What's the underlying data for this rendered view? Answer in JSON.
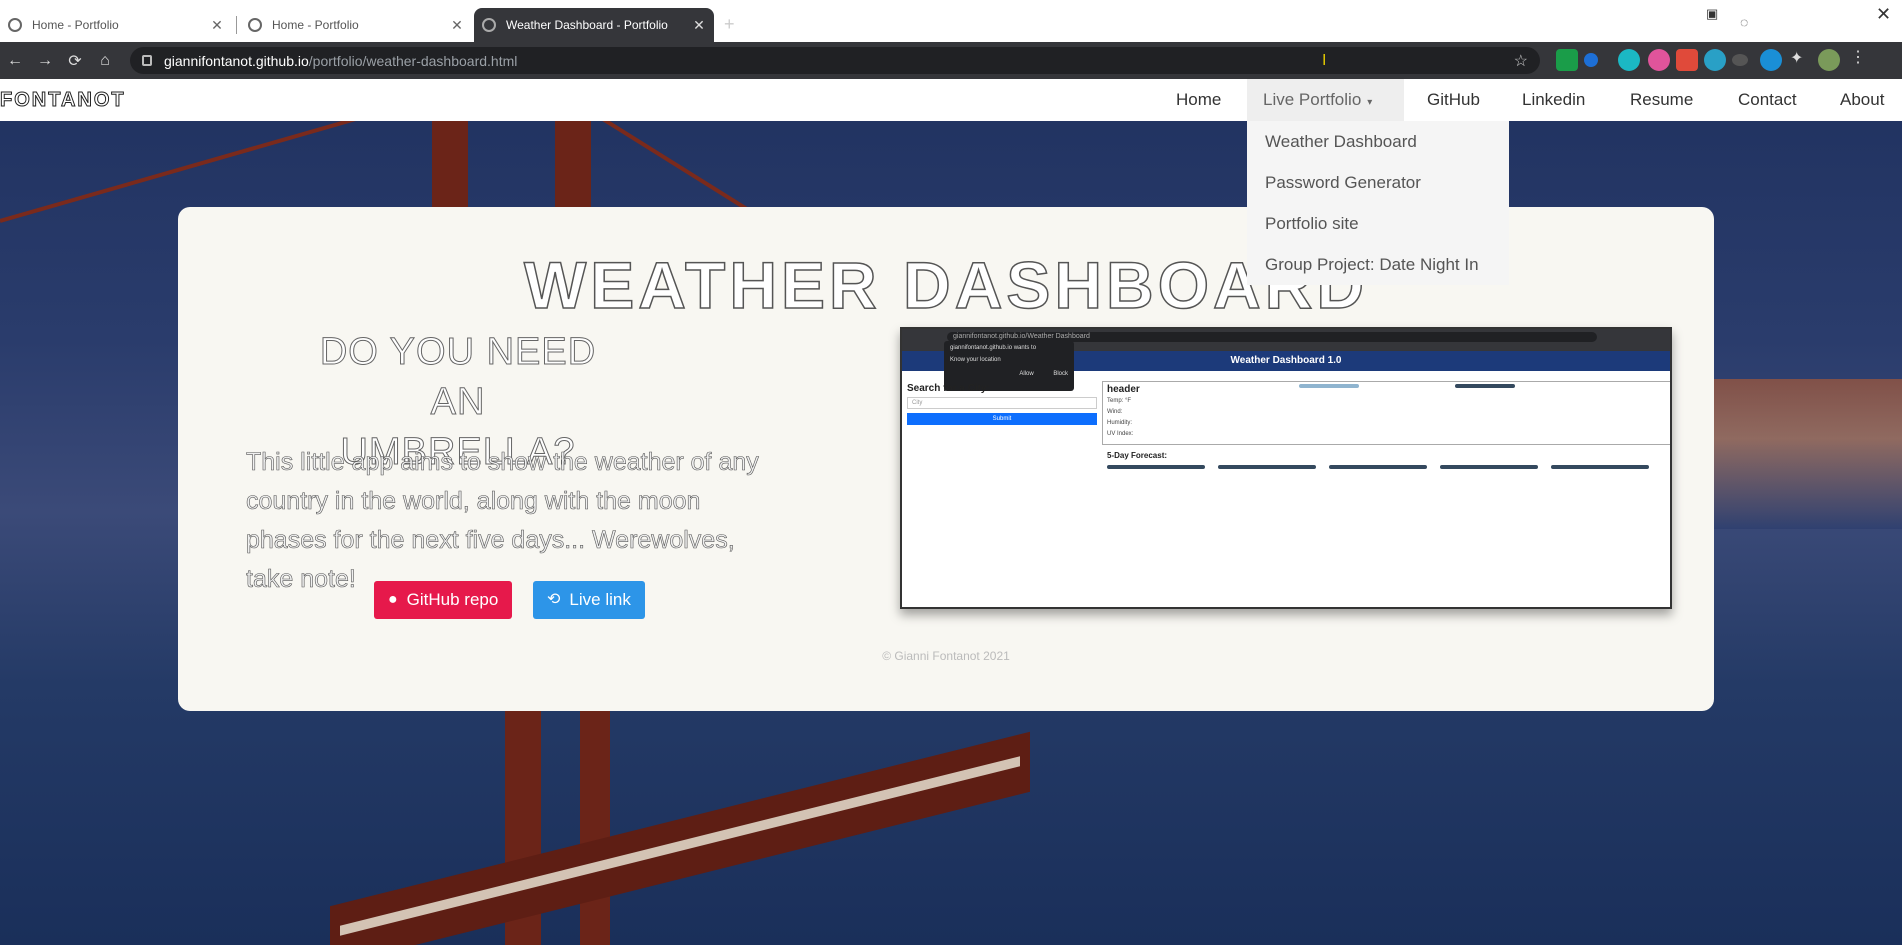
{
  "browser": {
    "tabs": [
      {
        "title": "Home - Portfolio",
        "active": false
      },
      {
        "title": "Home - Portfolio",
        "active": false
      },
      {
        "title": "Weather Dashboard - Portfolio",
        "active": true
      }
    ],
    "url_host": "giannifontanot.github.io",
    "url_path": "/portfolio/weather-dashboard.html"
  },
  "site": {
    "brand": "FONTANOT",
    "nav": [
      {
        "label": "Home"
      },
      {
        "label": "Live Portfolio",
        "has_dropdown": true
      },
      {
        "label": "GitHub"
      },
      {
        "label": "Linkedin"
      },
      {
        "label": "Resume"
      },
      {
        "label": "Contact"
      },
      {
        "label": "About"
      }
    ],
    "dropdown": [
      "Weather Dashboard",
      "Password Generator",
      "Portfolio site",
      "Group Project: Date Night In"
    ]
  },
  "project": {
    "title": "WEATHER DASHBOARD",
    "subtitle": "DO YOU NEED AN UMBRELLA?",
    "description": "This little app aims to show the weather of any country in the world, along with the moon phases for the next five days... Werewolves, take note!",
    "github_button": "GitHub repo",
    "live_button": "Live link"
  },
  "preview": {
    "url": "giannifontanot.github.io/Weather Dashboard",
    "header": "Weather Dashboard 1.0",
    "popup_title": "giannifontanot.github.io wants to",
    "popup_text": "Know your location",
    "popup_allow": "Allow",
    "popup_block": "Block",
    "search_title": "Search for a City:",
    "city_placeholder": "City",
    "submit": "Submit",
    "current_title": "header",
    "temp": "Temp: °F",
    "wind": "Wind:",
    "humidity": "Humidity:",
    "uv": "UV Index:",
    "forecast_title": "5-Day Forecast:"
  },
  "footer": "© Gianni Fontanot 2021",
  "colors": {
    "github_button": "#e6194b",
    "live_button": "#2d95e8",
    "preview_header": "#1c3a7a"
  }
}
